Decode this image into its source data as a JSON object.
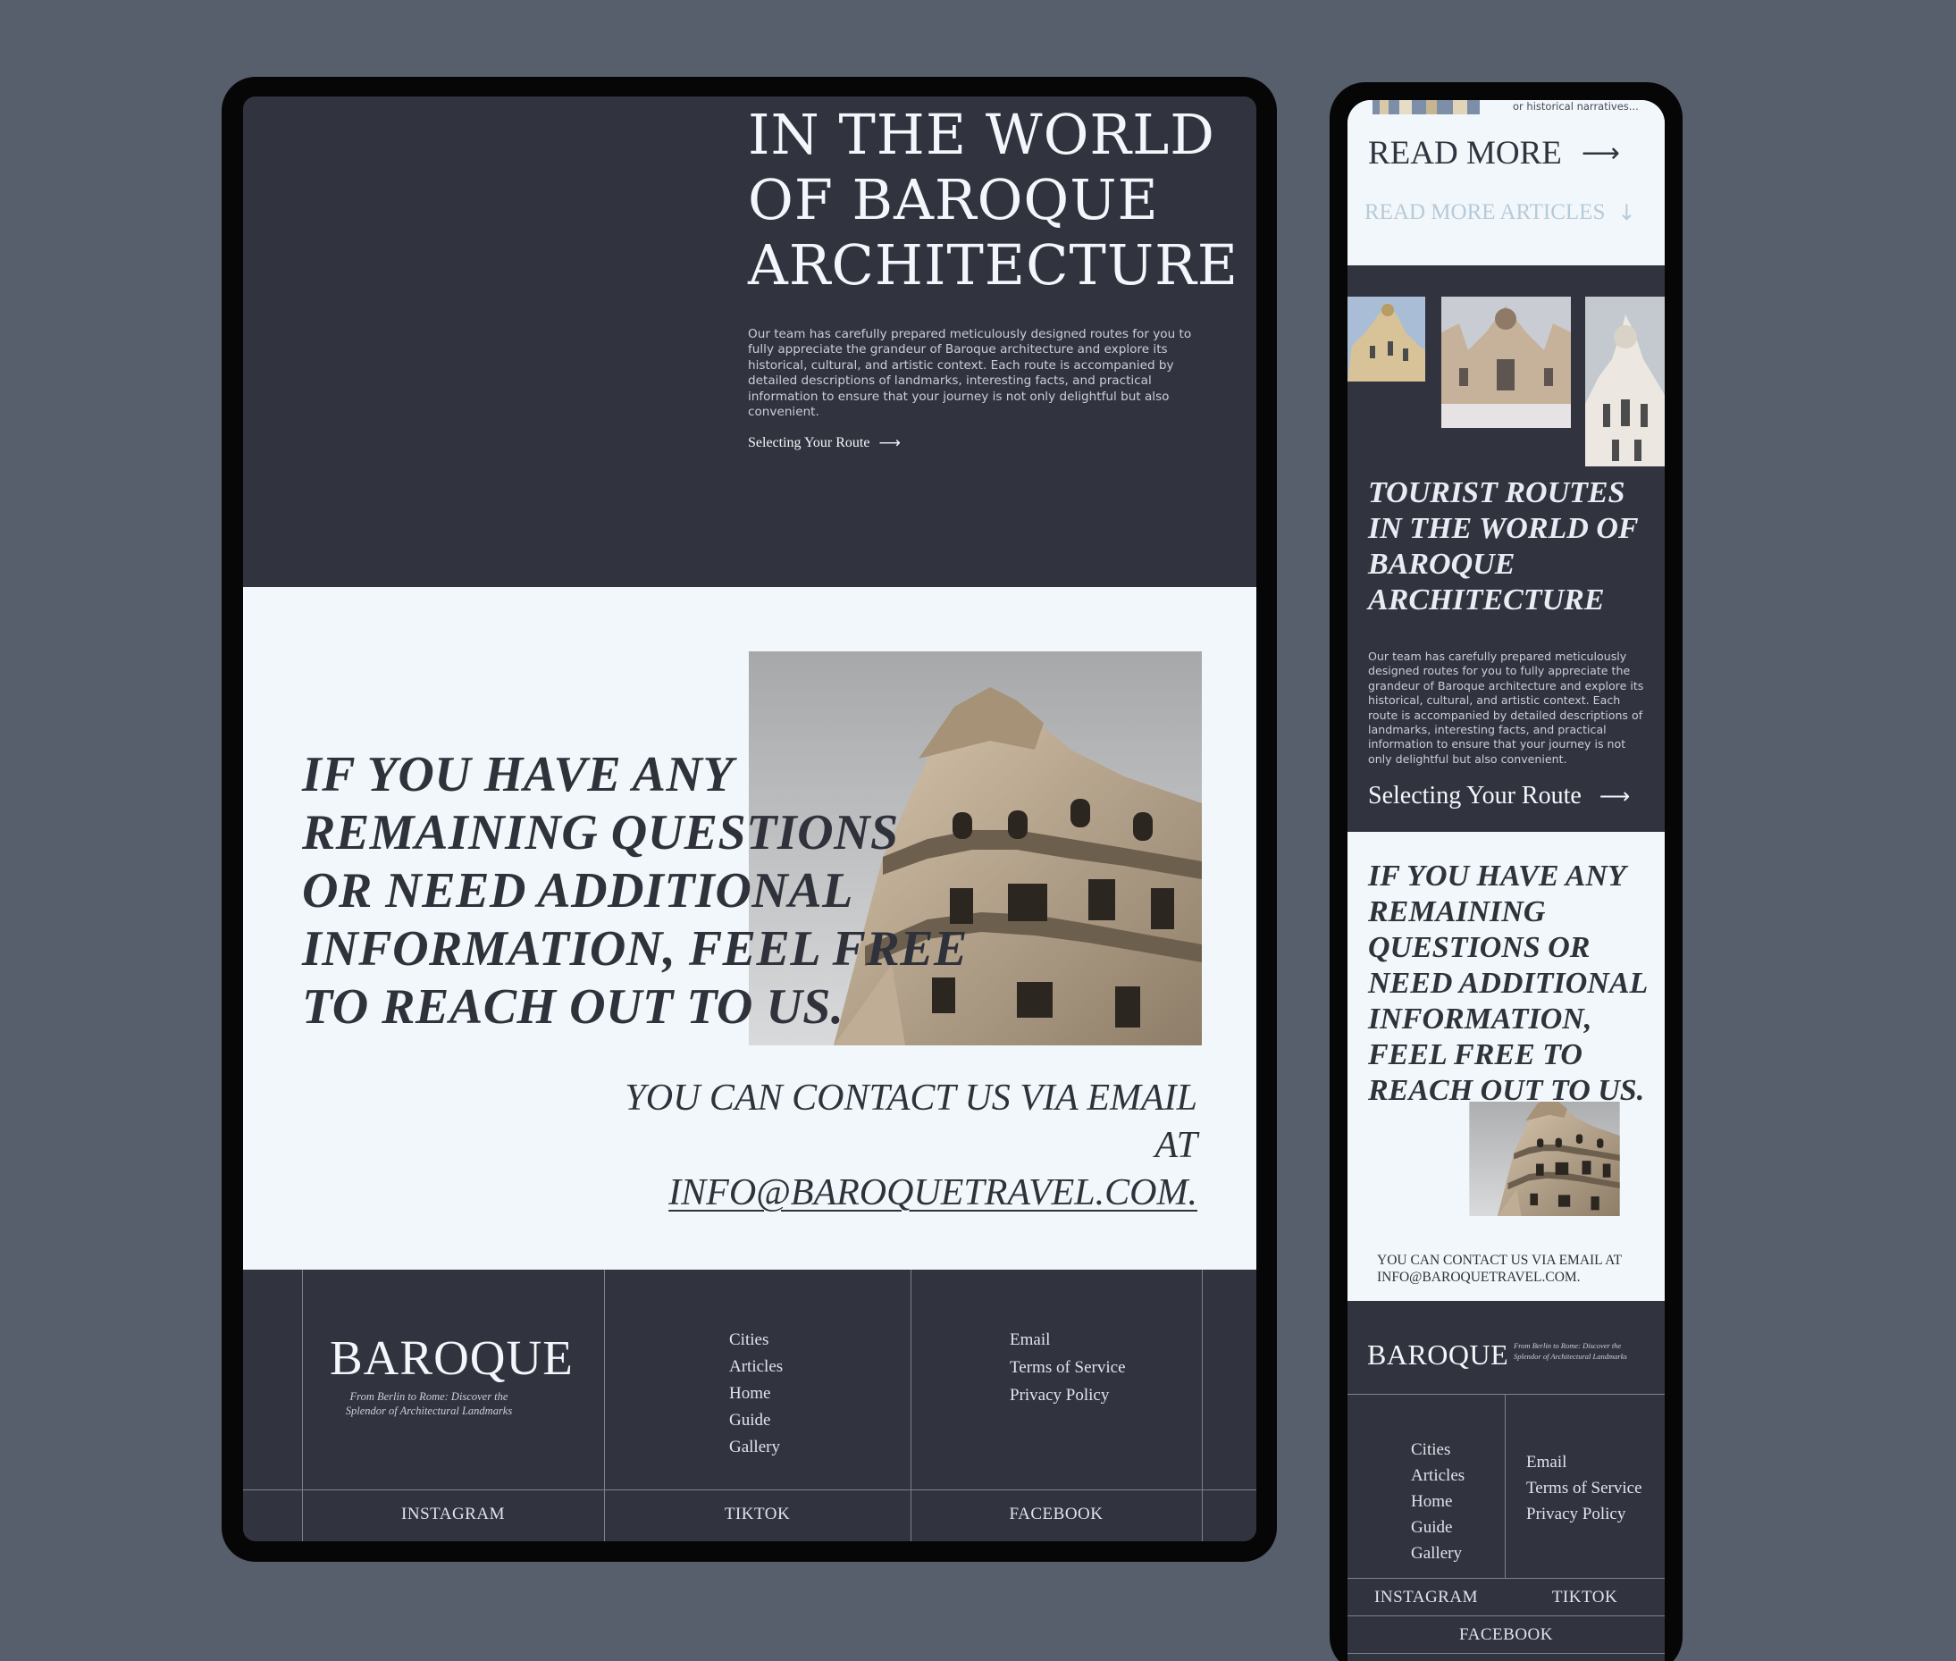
{
  "tablet": {
    "hero": {
      "title_lines": [
        "IN THE WORLD",
        "OF BAROQUE",
        "ARCHITECTURE"
      ],
      "description": "Our team has carefully prepared meticulously designed routes for you to fully appreciate the grandeur of Baroque architecture and explore its historical, cultural, and artistic context. Each route is accompanied by detailed descriptions of landmarks, interesting facts, and practical information to ensure that your journey is not only delightful but also convenient.",
      "route_link": "Selecting Your Route",
      "route_arrow": "⟶"
    },
    "contact": {
      "heading_lines": [
        "IF YOU HAVE ANY",
        "REMAINING QUESTIONS",
        "OR NEED ADDITIONAL",
        "INFORMATION, FEEL FREE",
        "TO REACH OUT TO US."
      ],
      "email_line1": "YOU CAN CONTACT US VIA EMAIL",
      "email_prefix": "AT ",
      "email_address": "INFO@BAROQUETRAVEL.COM."
    },
    "footer": {
      "brand": "BAROQUE",
      "tagline": "From Berlin to Rome: Discover the Splendor of Architectural Landmarks",
      "nav": [
        "Cities",
        "Articles",
        "Home",
        "Guide",
        "Gallery"
      ],
      "legal": [
        "Email",
        "Terms of Service",
        "Privacy Policy"
      ],
      "social": [
        "INSTAGRAM",
        "TIKTOK",
        "FACEBOOK"
      ]
    }
  },
  "phone": {
    "top": {
      "snippet": "or historical narratives...",
      "read_more": "READ MORE",
      "read_more_arrow": "⟶",
      "read_more_articles": "READ MORE ARTICLES",
      "articles_arrow": "↓"
    },
    "routes": {
      "title_lines": [
        "TOURIST ROUTES",
        "IN THE WORLD OF",
        "BAROQUE",
        "ARCHITECTURE"
      ],
      "description": "Our team has carefully prepared meticulously designed routes for you to fully appreciate the grandeur of Baroque architecture and explore its historical, cultural, and artistic context. Each route is accompanied by detailed descriptions of landmarks, interesting facts, and practical information to ensure that your journey is not only delightful but also convenient.",
      "route_link": "Selecting Your Route",
      "route_arrow": "⟶"
    },
    "contact": {
      "heading_lines": [
        "IF YOU HAVE ANY",
        "REMAINING",
        "QUESTIONS OR",
        "NEED ADDITIONAL",
        "INFORMATION,",
        "FEEL FREE TO",
        "REACH OUT TO US."
      ],
      "email_line1": "YOU CAN CONTACT US VIA EMAIL AT",
      "email_line2": "INFO@BAROQUETRAVEL.COM."
    },
    "footer": {
      "brand": "BAROQUE",
      "tagline": "From Berlin to Rome: Discover the Splendor of Architectural Landmarks",
      "nav": [
        "Cities",
        "Articles",
        "Home",
        "Guide",
        "Gallery"
      ],
      "legal": [
        "Email",
        "Terms of Service",
        "Privacy Policy"
      ],
      "social": [
        "INSTAGRAM",
        "TIKTOK",
        "FACEBOOK"
      ]
    }
  },
  "colors": {
    "background": "#575e6c",
    "dark_section": "#31343e",
    "light_section": "#f2f7fb",
    "muted_link": "#b7cad8"
  }
}
